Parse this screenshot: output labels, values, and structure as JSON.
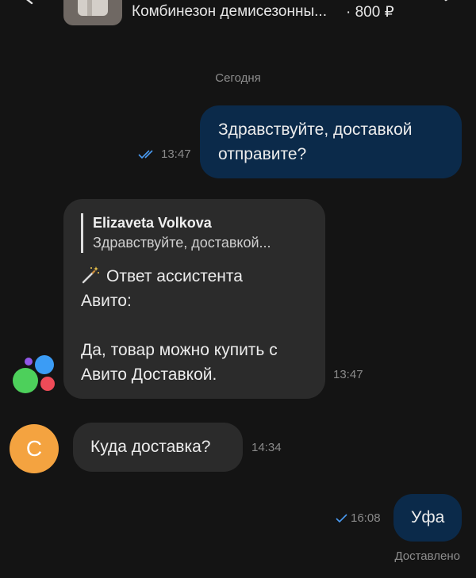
{
  "header": {
    "listing_title": "Комбинезон демисезонны...",
    "listing_price": "· 800 ₽"
  },
  "date_divider": "Сегодня",
  "messages": [
    {
      "direction": "outgoing",
      "lines": [
        "Здравствуйте, доставкой",
        "отправите?"
      ],
      "time": "13:47",
      "status": "read"
    },
    {
      "direction": "incoming",
      "sender": "Avito",
      "quote": {
        "author": "Elizaveta Volkova",
        "text": "Здравствуйте, доставкой..."
      },
      "heading": [
        "Ответ ассистента",
        "Авито:"
      ],
      "lines": [
        "Да, товар можно купить с",
        "Авито Доставкой."
      ],
      "time": "13:47"
    },
    {
      "direction": "incoming",
      "sender_initial": "C",
      "text": "Куда доставка?",
      "time": "14:34"
    },
    {
      "direction": "outgoing",
      "text": "Уфа",
      "time": "16:08",
      "status": "delivered"
    }
  ],
  "delivery_status": "Доставлено",
  "icons": {
    "back": "chevron-left-icon",
    "action": "mail-icon",
    "read": "double-check-icon",
    "delivered": "check-icon",
    "assistant": "magic-wand-icon"
  },
  "colors": {
    "background": "#141414",
    "outgoing_bubble": "#0b2a4a",
    "incoming_bubble": "#2b2b2b",
    "read_check": "#4a9bf2",
    "avatar": "#f4a340",
    "avito_blue": "#3b9cf5",
    "avito_purple": "#9258e8",
    "avito_green": "#4dd05b",
    "avito_red": "#ef4b58"
  }
}
